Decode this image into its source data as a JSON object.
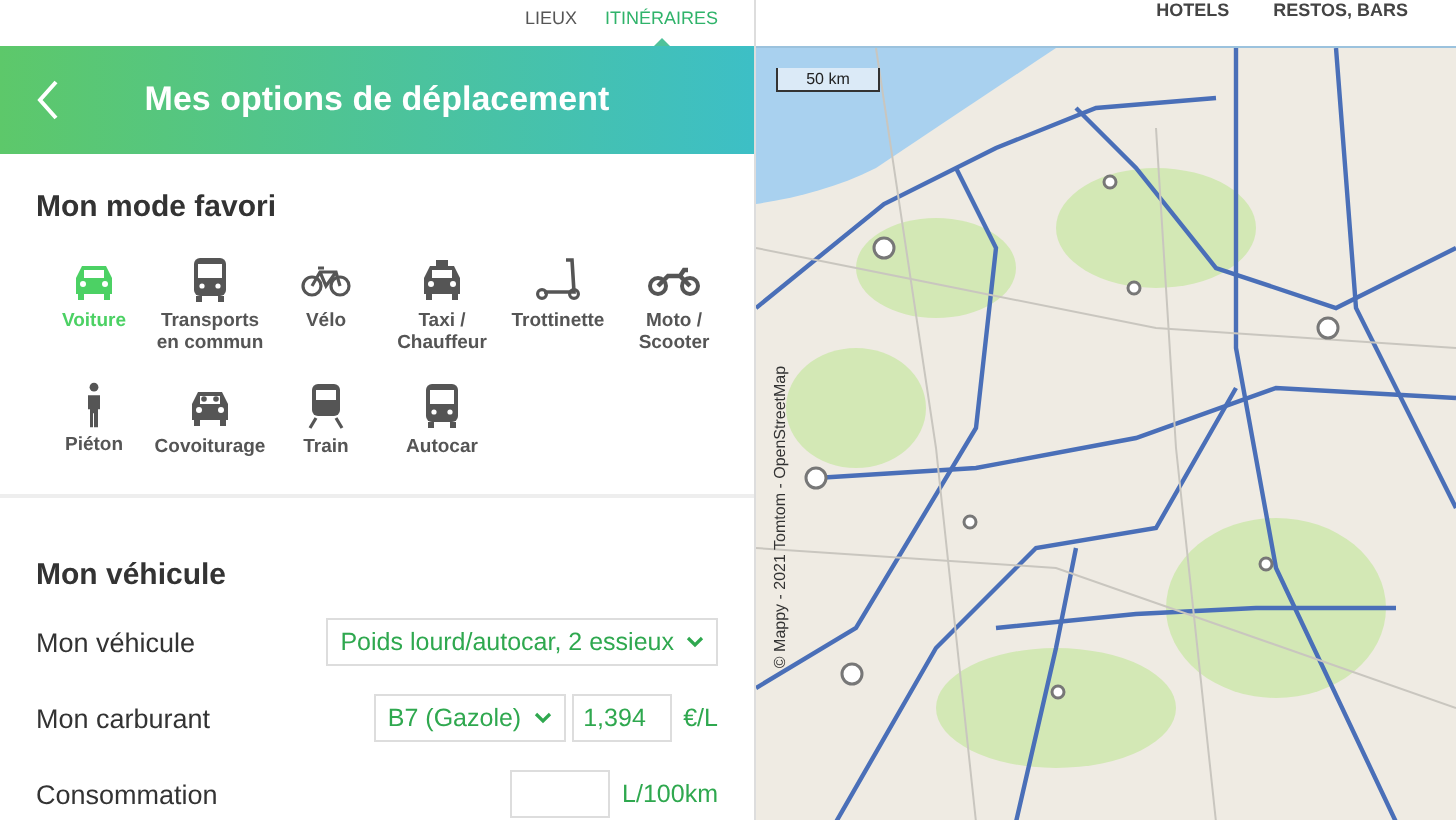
{
  "nav": {
    "tabs": [
      {
        "label": "LIEUX",
        "selected": false
      },
      {
        "label": "ITINÉRAIRES",
        "selected": true
      }
    ],
    "links": [
      "HOTELS",
      "RESTOS, BARS"
    ]
  },
  "panel": {
    "title": "Mes options de déplacement",
    "favorite": {
      "heading": "Mon mode favori",
      "modes": [
        {
          "kind": "car",
          "label": "Voiture",
          "selected": true
        },
        {
          "kind": "bus",
          "label": "Transports en commun",
          "selected": false
        },
        {
          "kind": "bike",
          "label": "Vélo",
          "selected": false
        },
        {
          "kind": "taxi",
          "label": "Taxi / Chauffeur",
          "selected": false
        },
        {
          "kind": "scooter",
          "label": "Trottinette",
          "selected": false
        },
        {
          "kind": "moto",
          "label": "Moto / Scooter",
          "selected": false
        },
        {
          "kind": "walk",
          "label": "Piéton",
          "selected": false
        },
        {
          "kind": "carpool",
          "label": "Covoiturage",
          "selected": false
        },
        {
          "kind": "train",
          "label": "Train",
          "selected": false
        },
        {
          "kind": "coach",
          "label": "Autocar",
          "selected": false
        }
      ]
    },
    "vehicle": {
      "heading": "Mon véhicule",
      "rows": [
        {
          "kind": "select",
          "label": "Mon véhicule",
          "value": "Poids lourd/autocar, 2 essieux"
        },
        {
          "kind": "fuel",
          "label": "Mon carburant",
          "value": "B7 (Gazole)",
          "price": "1,394",
          "unit": "€/L"
        },
        {
          "kind": "consumption",
          "label": "Consommation",
          "unit": "L/100km"
        }
      ]
    }
  },
  "map": {
    "scale": "50 km",
    "attribution": "© Mappy - 2021 Tomtom - OpenStreetMap"
  }
}
